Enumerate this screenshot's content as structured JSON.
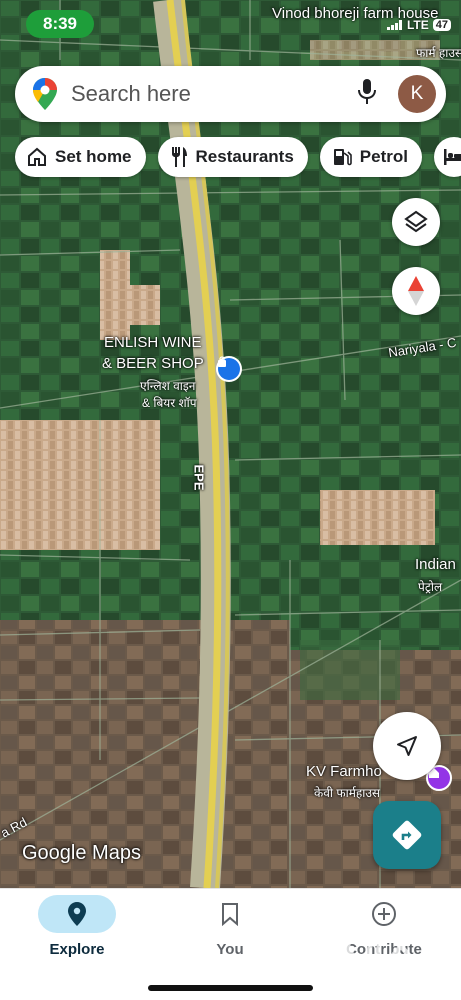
{
  "status_bar": {
    "time": "8:39",
    "network": "LTE",
    "battery": "47"
  },
  "search": {
    "placeholder": "Search here",
    "avatar_initial": "K",
    "icons": {
      "logo": "maps-pin-icon",
      "mic": "mic-icon"
    }
  },
  "chips": [
    {
      "label": "Set home",
      "icon": "home-icon"
    },
    {
      "label": "Restaurants",
      "icon": "restaurant-icon"
    },
    {
      "label": "Petrol",
      "icon": "fuel-icon"
    },
    {
      "label": "",
      "icon": "hotel-icon"
    }
  ],
  "map_labels": {
    "farmhouse_top": "Vinod bhoreji farm house",
    "farmhouse_top_hindi": "फार्म हाउस",
    "shop_line1": "ENLISH WINE",
    "shop_line2": "& BEER SHOP",
    "shop_hindi_line1": "एन्लिश वाइन",
    "shop_hindi_line2": "& बियर शॉप",
    "road_right": "Nariyala - C",
    "highway": "EPE",
    "indian_oil": "Indian",
    "indian_oil_hindi": "पेट्रोल",
    "kv_farmhouse": "KV Farmho",
    "kv_farmhouse_hindi": "केवी फार्महाउस",
    "road_left": "a Rd",
    "logo": "Google Maps"
  },
  "bottom_nav": [
    {
      "label": "Explore",
      "icon": "explore-pin-icon",
      "active": true
    },
    {
      "label": "You",
      "icon": "bookmark-icon",
      "active": false
    },
    {
      "label": "Contribute",
      "icon": "add-circle-icon",
      "active": false
    }
  ],
  "colors": {
    "time_pill": "#1e9e3a",
    "directions_fab": "#1b7f8a",
    "nav_active": "#bfe6f7",
    "avatar": "#8d5a45",
    "poi_shop": "#1a73e8",
    "poi_farmhouse": "#9334e6"
  }
}
